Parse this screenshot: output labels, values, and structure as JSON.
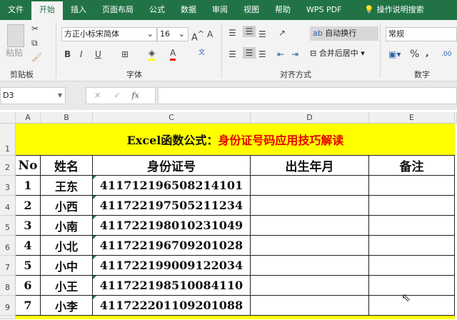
{
  "tabs": [
    "文件",
    "开始",
    "插入",
    "页面布局",
    "公式",
    "数据",
    "审阅",
    "视图",
    "帮助",
    "WPS PDF"
  ],
  "search_label": "操作说明搜索",
  "ribbon": {
    "paste_label": "粘贴",
    "clipboard_group": "剪贴板",
    "font_name": "方正小标宋简体",
    "font_size": "16",
    "font_group": "字体",
    "bold": "B",
    "italic": "I",
    "underline": "U",
    "wrap_text": "自动换行",
    "merge_center": "合并后居中",
    "align_group": "对齐方式",
    "number_format": "常规",
    "percent": "%",
    "comma": ",",
    "number_group": "数字"
  },
  "formula_bar": {
    "name_box": "D3",
    "fx": "fx",
    "formula": ""
  },
  "columns": [
    "A",
    "B",
    "C",
    "D",
    "E"
  ],
  "rows": [
    "1",
    "2",
    "3",
    "4",
    "5",
    "6",
    "7",
    "8",
    "9"
  ],
  "title": {
    "black": "Excel函数公式：",
    "red": "身份证号码应用技巧解读"
  },
  "headers": [
    "No",
    "姓名",
    "身份证号",
    "出生年月",
    "备注"
  ],
  "records": [
    [
      "1",
      "王东",
      "411712196508214101",
      "",
      ""
    ],
    [
      "2",
      "小西",
      "411722197505211234",
      "",
      ""
    ],
    [
      "3",
      "小南",
      "411722198010231049",
      "",
      ""
    ],
    [
      "4",
      "小北",
      "411722196709201028",
      "",
      ""
    ],
    [
      "5",
      "小中",
      "411722199009122034",
      "",
      ""
    ],
    [
      "6",
      "小王",
      "411722198510084110",
      "",
      ""
    ],
    [
      "7",
      "小李",
      "411722201109201088",
      "",
      ""
    ]
  ],
  "colors": {
    "ribbon_green": "#217346",
    "title_bg": "#ffff00",
    "title_red": "#e60000"
  }
}
